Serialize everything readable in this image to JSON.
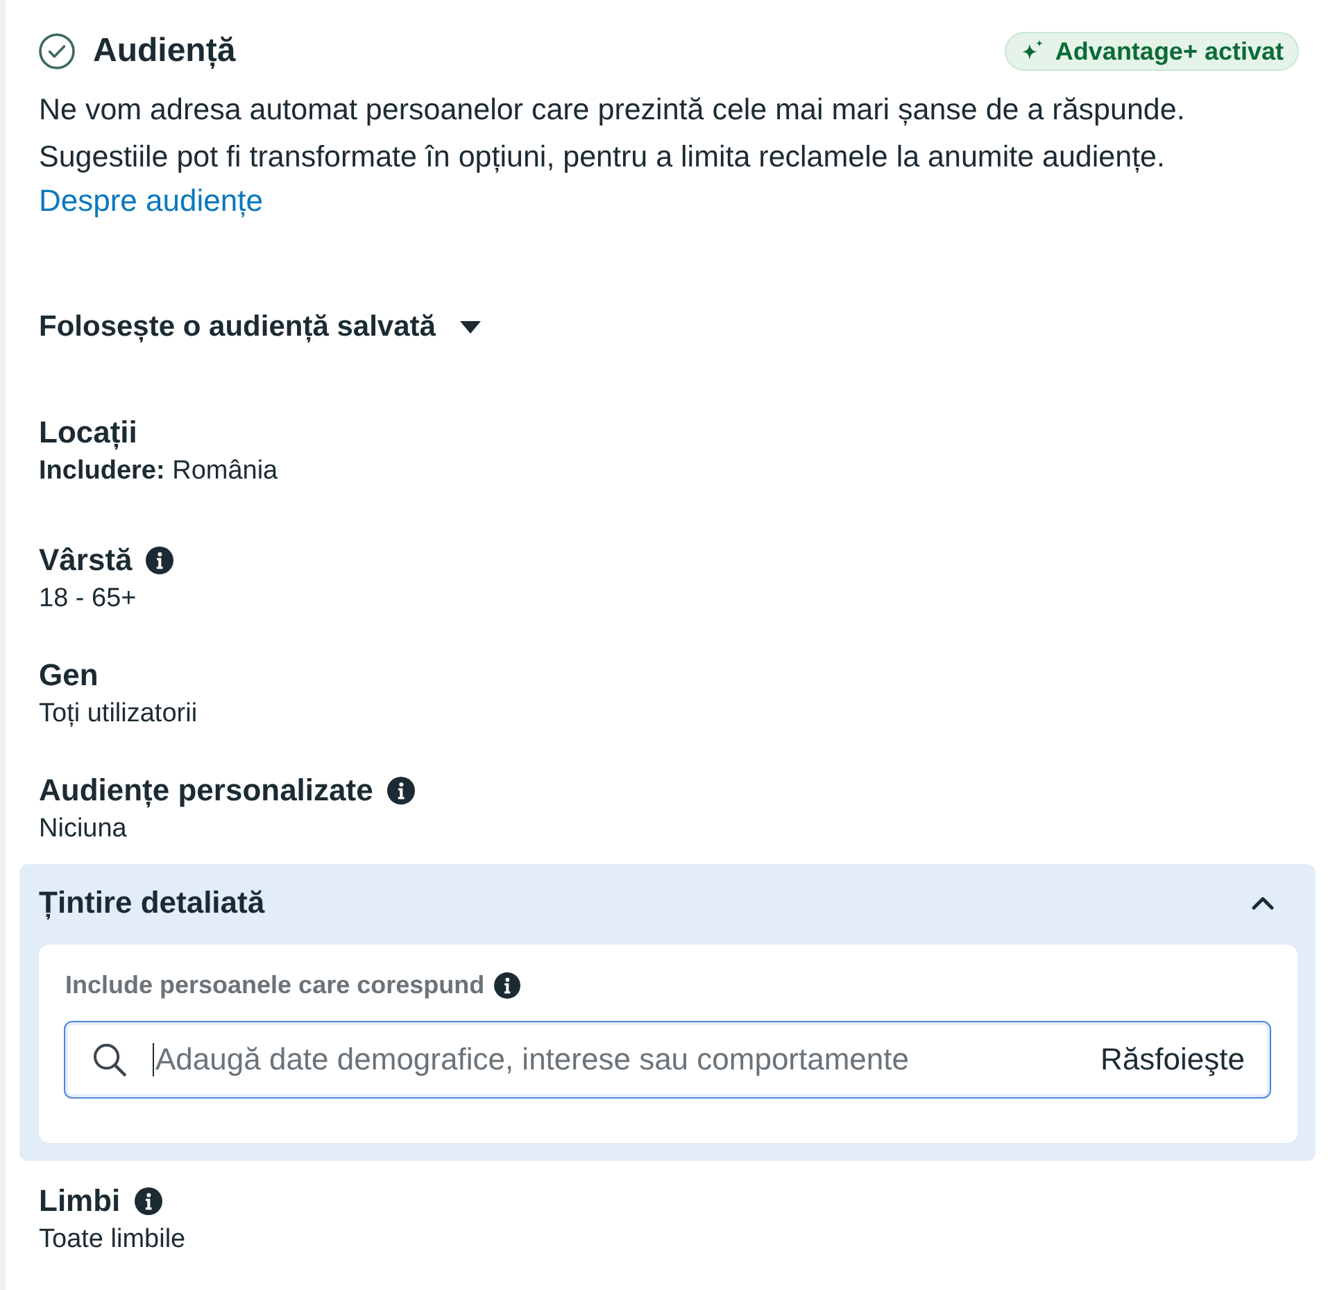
{
  "section": {
    "title": "Audiență",
    "completed": true,
    "badge": {
      "label": "Advantage+ activat"
    },
    "description": [
      "Ne vom adresa automat persoanelor care prezintă cele mai mari șanse de a răspunde.",
      "Sugestiile pot fi transformate în opțiuni, pentru a limita reclamele la anumite audiențe."
    ],
    "link": "Despre audiențe"
  },
  "saved_audience": {
    "label": "Folosește o audiență salvată",
    "expanded": false
  },
  "fields": [
    {
      "label": "Locații",
      "value": "**Includere:** România",
      "info": false
    },
    {
      "label": "Vârstă",
      "value": "18 - 65+",
      "info": true
    },
    {
      "label": "Gen",
      "value": "Toți utilizatorii",
      "info": false
    },
    {
      "label": "Audiențe personalizate",
      "value": "Niciuna",
      "info": true
    }
  ],
  "detailed_targeting": {
    "title": "Țintire detaliată",
    "expanded": true,
    "label": "Include persoanele care corespund",
    "info": true,
    "search": {
      "placeholder": "Adaugă date demografice, interese sau comportamente",
      "focused": true,
      "browse": "Răsfoieşte"
    }
  },
  "fields_after": [
    {
      "label": "Limbi",
      "value": "Toate limbile",
      "info": true
    }
  ]
}
